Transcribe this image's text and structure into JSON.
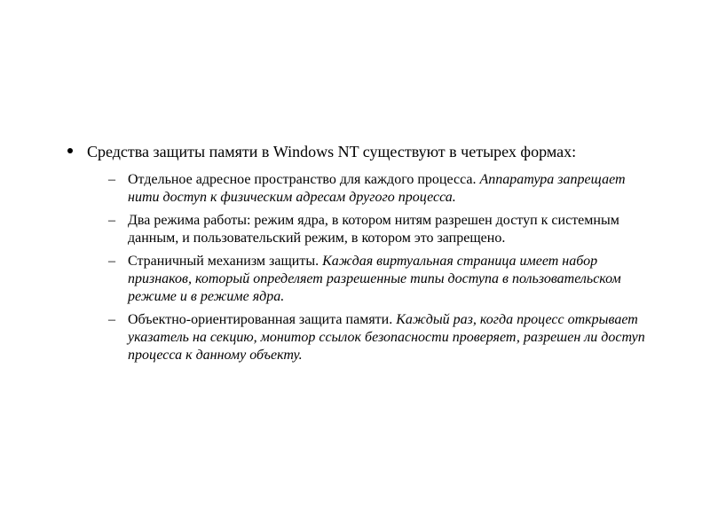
{
  "main": {
    "intro": "Средства защиты памяти в Windows NT существуют в четырех формах:",
    "items": [
      {
        "lead": "Отдельное адресное пространство для каждого процесса. ",
        "detail": "Аппаратура запрещает нити доступ к физическим адресам другого процесса."
      },
      {
        "lead": "Два режима работы: режим ядра, в котором нитям разрешен доступ к системным данным, и пользовательский режим, в котором это запрещено.",
        "detail": ""
      },
      {
        "lead": "Страничный механизм защиты. ",
        "detail": "Каждая виртуальная страница имеет набор признаков, который определяет разрешенные типы доступа в пользовательском режиме и в режиме ядра."
      },
      {
        "lead": "Объектно-ориентированная защита памяти. ",
        "detail": "Каждый раз, когда процесс открывает указатель на секцию, монитор ссылок безопасности проверяет, разрешен ли доступ процесса к данному объекту."
      }
    ]
  }
}
